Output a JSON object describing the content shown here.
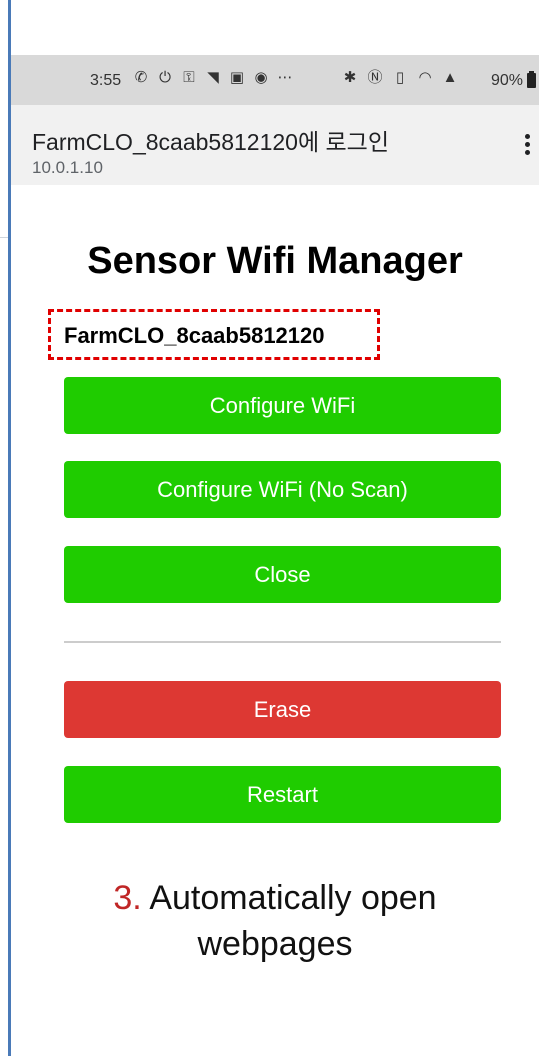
{
  "status_bar": {
    "time": "3:55",
    "left_icons": [
      "whatsapp-icon",
      "power-icon",
      "lock-icon",
      "wifi-question-icon",
      "gallery-icon",
      "chrome-icon",
      "more-dots-icon"
    ],
    "right_icons": [
      "bluetooth-icon",
      "nfc-icon",
      "vibrate-icon",
      "wifi-icon",
      "signal-icon"
    ],
    "battery": "90%"
  },
  "app_bar": {
    "title": "FarmCLO_8caab5812120에 로그인",
    "subtitle": "10.0.1.10"
  },
  "page": {
    "heading": "Sensor Wifi Manager",
    "device_name": "FarmCLO_8caab5812120",
    "buttons": {
      "configure_wifi": "Configure WiFi",
      "configure_wifi_noscan": "Configure WiFi (No Scan)",
      "close": "Close",
      "erase": "Erase",
      "restart": "Restart"
    }
  },
  "caption": {
    "number": "3.",
    "text_line1": " Automatically open",
    "text_line2": "webpages"
  },
  "colors": {
    "button_green": "#1fcc00",
    "button_red": "#dd3833",
    "highlight_dash": "#e00000",
    "caption_number": "#c02626"
  }
}
